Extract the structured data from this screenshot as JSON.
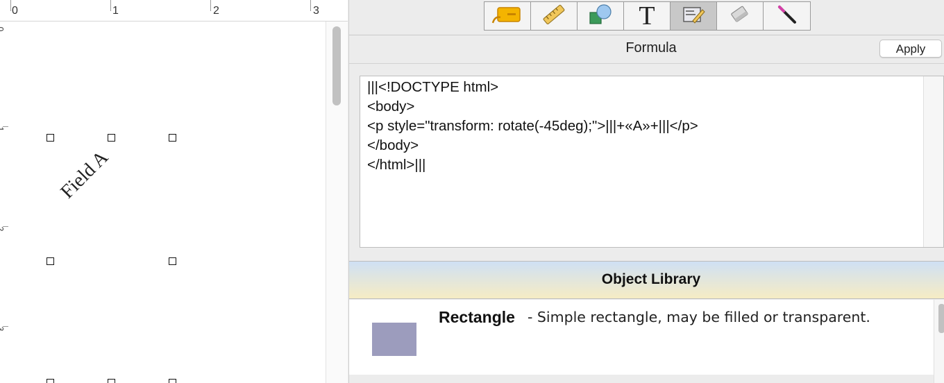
{
  "ruler": {
    "h_labels": [
      "0",
      "1",
      "2",
      "3"
    ],
    "v_labels": [
      "0",
      "1",
      "2",
      "3"
    ]
  },
  "canvas": {
    "field_label": "Field A"
  },
  "toolbar": {
    "tools": [
      "label-tool-icon",
      "ruler-tool-icon",
      "shapes-tool-icon",
      "text-tool-icon",
      "formula-tool-icon",
      "eraser-tool-icon",
      "magic-wand-tool-icon"
    ],
    "active_tool": "formula-tool-icon",
    "text_tool_glyph": "T"
  },
  "formula": {
    "title": "Formula",
    "apply_label": "Apply",
    "content": "|||<!DOCTYPE html>\n<body>\n<p style=\"transform: rotate(-45deg);\">|||+«A»+|||</p>\n</body>\n</html>|||"
  },
  "library": {
    "title": "Object Library",
    "items": [
      {
        "name": "Rectangle",
        "description": "- Simple rectangle, may be filled or transparent.",
        "swatch_color": "#9c9cbd"
      }
    ]
  }
}
